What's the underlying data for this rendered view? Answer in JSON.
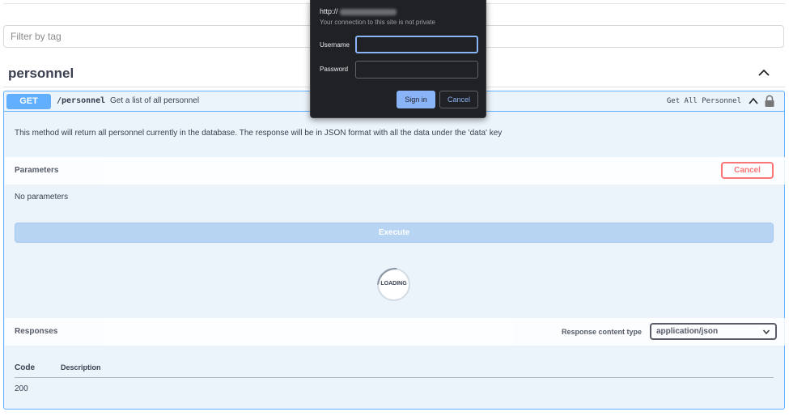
{
  "filter": {
    "placeholder": "Filter by tag"
  },
  "tag": {
    "title": "personnel",
    "toggle_icon": "chevron-up-icon"
  },
  "operation": {
    "method": "GET",
    "path": "/personnel",
    "summary": "Get a list of all personnel",
    "operation_id": "Get All Personnel",
    "description": "This method will return all personnel currently in the database. The response will be in JSON format with all the data under the 'data' key",
    "colors": {
      "get": "#61affe",
      "cancel": "#ff6060"
    }
  },
  "parameters": {
    "title": "Parameters",
    "cancel_label": "Cancel",
    "empty_text": "No parameters",
    "execute_label": "Execute"
  },
  "loading": {
    "text": "LOADING"
  },
  "responses": {
    "title": "Responses",
    "content_type_label": "Response content type",
    "content_type_value": "application/json",
    "columns": [
      "Code",
      "Description"
    ],
    "rows": [
      {
        "code": "200",
        "description": ""
      }
    ]
  },
  "auth_dialog": {
    "url_prefix": "http://",
    "warning": "Your connection to this site is not private",
    "username_label": "Username",
    "password_label": "Password",
    "username_value": "",
    "password_value": "",
    "signin_label": "Sign in",
    "cancel_label": "Cancel",
    "accent": "#8ab4f8"
  }
}
